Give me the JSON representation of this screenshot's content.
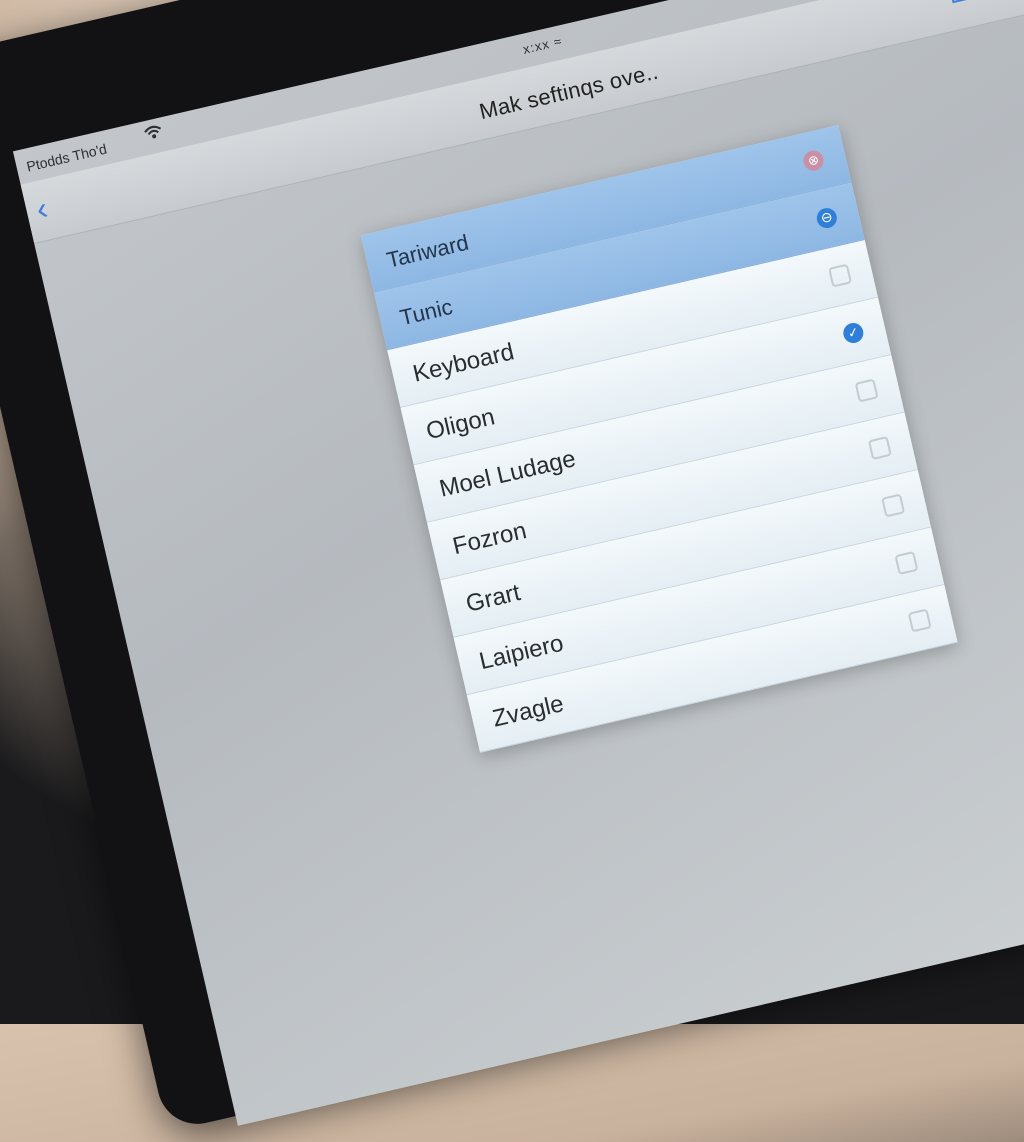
{
  "status": {
    "carrier": "Ptodds Tho'd",
    "time": "x:xx ≈",
    "battery": "⁴"
  },
  "nav": {
    "title": "Mak seftinqs ove..",
    "back_glyph": "‹"
  },
  "list": {
    "items": [
      {
        "label": "Tariward",
        "selected": true,
        "control": "remove",
        "glyph": "⊗"
      },
      {
        "label": "Tunic",
        "selected": true,
        "control": "minus",
        "glyph": "⊖"
      },
      {
        "label": "Keyboard",
        "selected": false,
        "control": "checkbox",
        "glyph": ""
      },
      {
        "label": "Oligon",
        "selected": false,
        "control": "checked",
        "glyph": "✓"
      },
      {
        "label": "Moel Ludage",
        "selected": false,
        "control": "checkbox",
        "glyph": ""
      },
      {
        "label": "Fozron",
        "selected": false,
        "control": "checkbox",
        "glyph": ""
      },
      {
        "label": "Grart",
        "selected": false,
        "control": "checkbox",
        "glyph": ""
      },
      {
        "label": "Laipiero",
        "selected": false,
        "control": "checkbox",
        "glyph": ""
      },
      {
        "label": "Zvagle",
        "selected": false,
        "control": "checkbox",
        "glyph": ""
      }
    ]
  },
  "colors": {
    "accent": "#2f7fd9",
    "selected_row": "#9fc4ea",
    "remove": "#c98fa4"
  }
}
